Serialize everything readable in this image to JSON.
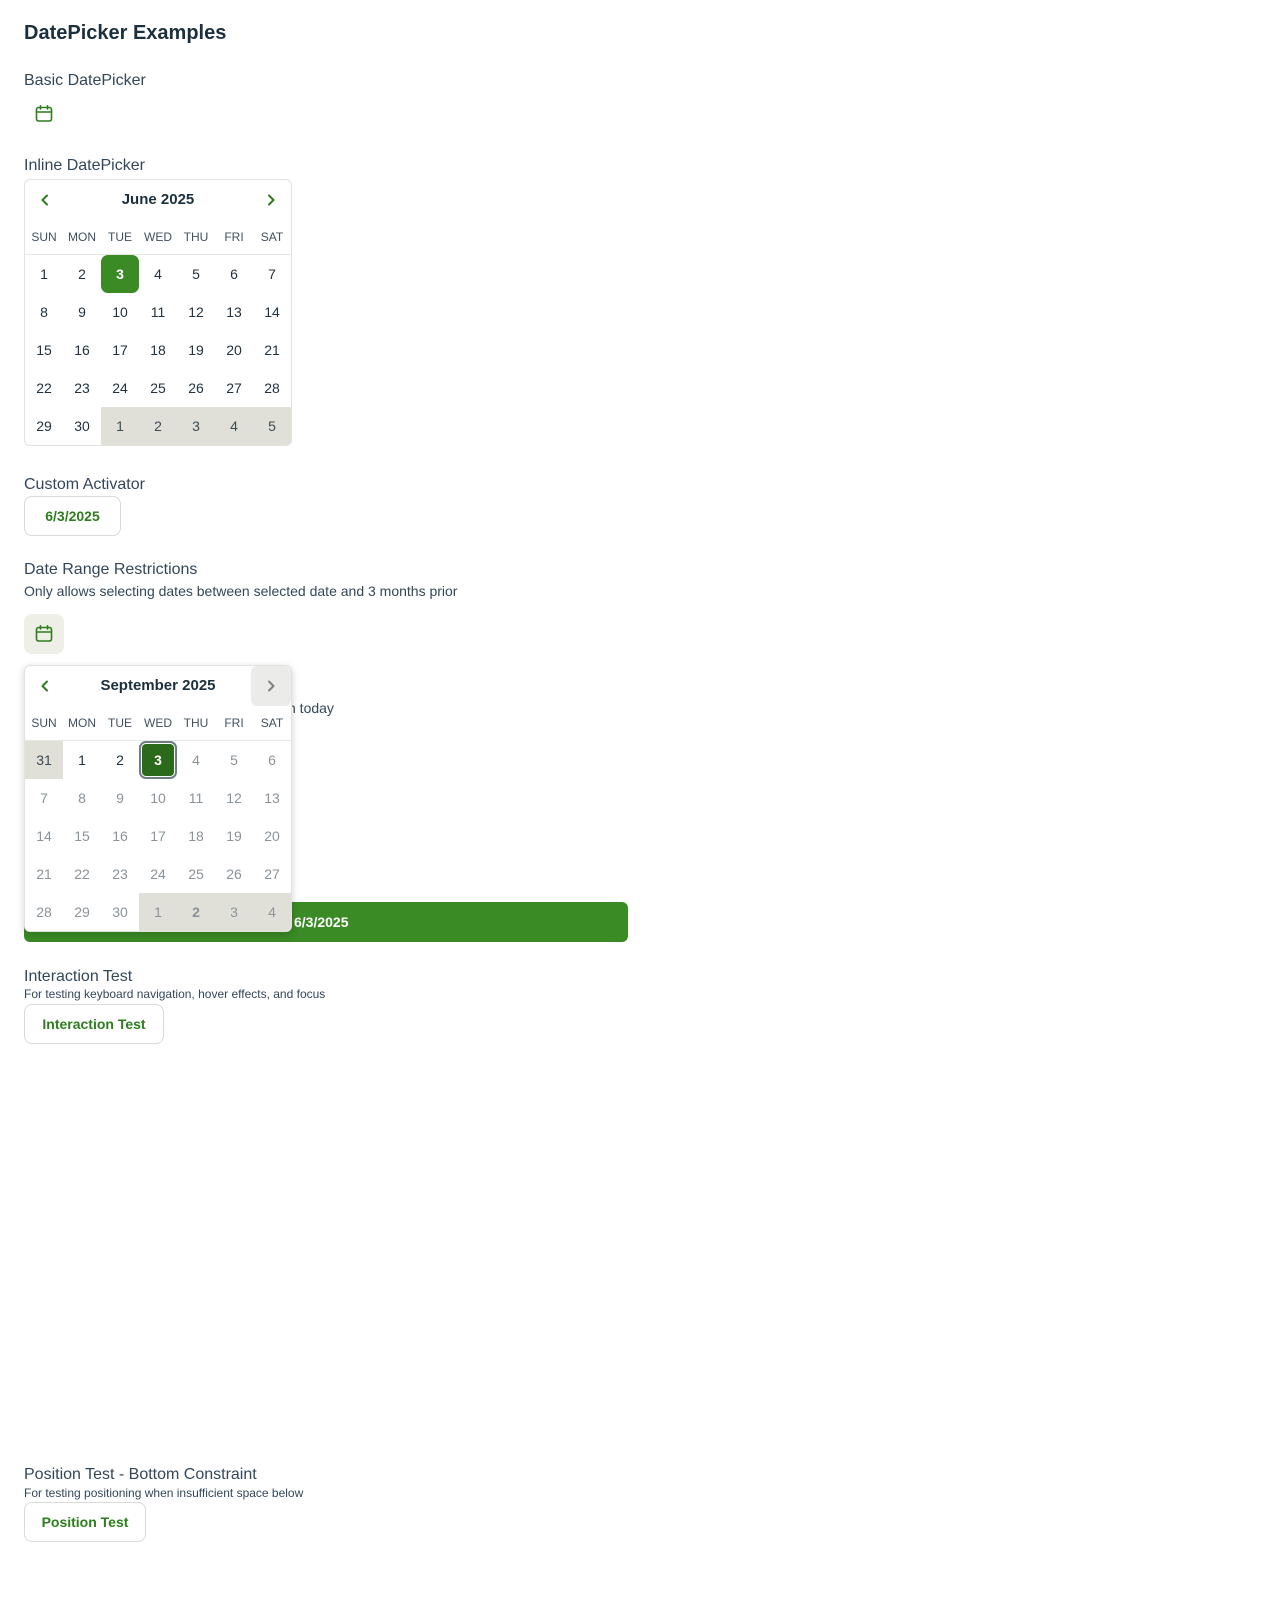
{
  "page": {
    "title": "DatePicker Examples"
  },
  "basic": {
    "label": "Basic DatePicker",
    "icon": "calendar-icon"
  },
  "inline": {
    "label": "Inline DatePicker",
    "calendar": {
      "month_label": "June 2025",
      "weekdays": [
        "SUN",
        "MON",
        "TUE",
        "WED",
        "THU",
        "FRI",
        "SAT"
      ],
      "weeks": [
        [
          {
            "d": "1"
          },
          {
            "d": "2"
          },
          {
            "d": "3",
            "state": "selected"
          },
          {
            "d": "4"
          },
          {
            "d": "5"
          },
          {
            "d": "6"
          },
          {
            "d": "7"
          }
        ],
        [
          {
            "d": "8"
          },
          {
            "d": "9"
          },
          {
            "d": "10"
          },
          {
            "d": "11"
          },
          {
            "d": "12"
          },
          {
            "d": "13"
          },
          {
            "d": "14"
          }
        ],
        [
          {
            "d": "15"
          },
          {
            "d": "16"
          },
          {
            "d": "17"
          },
          {
            "d": "18"
          },
          {
            "d": "19"
          },
          {
            "d": "20"
          },
          {
            "d": "21"
          }
        ],
        [
          {
            "d": "22"
          },
          {
            "d": "23"
          },
          {
            "d": "24"
          },
          {
            "d": "25"
          },
          {
            "d": "26"
          },
          {
            "d": "27"
          },
          {
            "d": "28"
          }
        ],
        [
          {
            "d": "29"
          },
          {
            "d": "30"
          },
          {
            "d": "1",
            "other": true
          },
          {
            "d": "2",
            "other": true
          },
          {
            "d": "3",
            "other": true
          },
          {
            "d": "4",
            "other": true
          },
          {
            "d": "5",
            "other": true
          }
        ]
      ]
    }
  },
  "custom": {
    "label": "Custom Activator",
    "button_text": "6/3/2025"
  },
  "range": {
    "label": "Date Range Restrictions",
    "description": "Only allows selecting dates between selected date and 3 months prior",
    "icon": "calendar-icon",
    "hidden_text_fragment": "n today",
    "popup": {
      "month_label": "September 2025",
      "weekdays": [
        "SUN",
        "MON",
        "TUE",
        "WED",
        "THU",
        "FRI",
        "SAT"
      ],
      "weeks": [
        [
          {
            "d": "31",
            "other": true
          },
          {
            "d": "1"
          },
          {
            "d": "2"
          },
          {
            "d": "3",
            "state": "selected-focus"
          },
          {
            "d": "4",
            "disabled": true
          },
          {
            "d": "5",
            "disabled": true
          },
          {
            "d": "6",
            "disabled": true
          }
        ],
        [
          {
            "d": "7",
            "disabled": true
          },
          {
            "d": "8",
            "disabled": true
          },
          {
            "d": "9",
            "disabled": true
          },
          {
            "d": "10",
            "disabled": true
          },
          {
            "d": "11",
            "disabled": true
          },
          {
            "d": "12",
            "disabled": true
          },
          {
            "d": "13",
            "disabled": true
          }
        ],
        [
          {
            "d": "14",
            "disabled": true
          },
          {
            "d": "15",
            "disabled": true
          },
          {
            "d": "16",
            "disabled": true
          },
          {
            "d": "17",
            "disabled": true
          },
          {
            "d": "18",
            "disabled": true
          },
          {
            "d": "19",
            "disabled": true
          },
          {
            "d": "20",
            "disabled": true
          }
        ],
        [
          {
            "d": "21",
            "disabled": true
          },
          {
            "d": "22",
            "disabled": true
          },
          {
            "d": "23",
            "disabled": true
          },
          {
            "d": "24",
            "disabled": true
          },
          {
            "d": "25",
            "disabled": true
          },
          {
            "d": "26",
            "disabled": true
          },
          {
            "d": "27",
            "disabled": true
          }
        ],
        [
          {
            "d": "28",
            "disabled": true
          },
          {
            "d": "29",
            "disabled": true
          },
          {
            "d": "30",
            "disabled": true
          },
          {
            "d": "1",
            "other": true,
            "disabled": true
          },
          {
            "d": "2",
            "other": true,
            "disabled": true,
            "bold": true
          },
          {
            "d": "3",
            "other": true,
            "disabled": true
          },
          {
            "d": "4",
            "other": true,
            "disabled": true
          }
        ]
      ]
    }
  },
  "bar": {
    "text": "6/3/2025"
  },
  "interaction": {
    "label": "Interaction Test",
    "description": "For testing keyboard navigation, hover effects, and focus",
    "button_text": "Interaction Test"
  },
  "position": {
    "label": "Position Test - Bottom Constraint",
    "description": "For testing positioning when insufficient space below",
    "button_text": "Position Test"
  },
  "colors": {
    "accent": "#3a8a26",
    "accent_dark": "#2b6a1a",
    "other_month_bg": "#e0e0d8"
  }
}
